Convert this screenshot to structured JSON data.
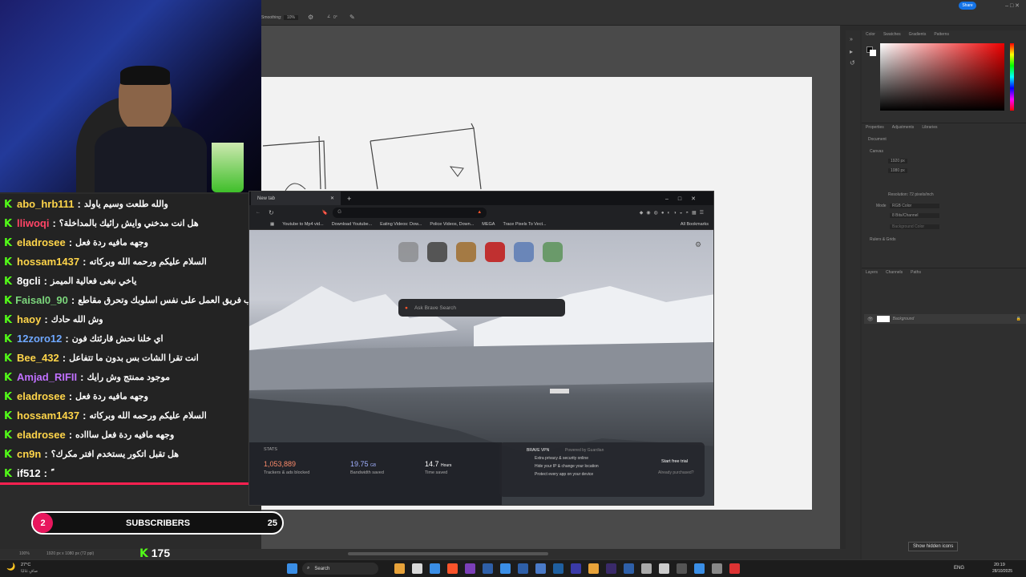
{
  "photoshop": {
    "options": {
      "smoothing": "Smoothing:",
      "smoothing_val": "10%",
      "angle": "0°",
      "share": "Share"
    },
    "right_tabs": [
      "Color",
      "Swatches",
      "Gradients",
      "Patterns"
    ],
    "props_tabs": [
      "Properties",
      "Adjustments",
      "Libraries"
    ],
    "doc_label": "Document",
    "canvas_label": "Canvas",
    "w": "1920 px",
    "h": "1080 px",
    "resolution": "Resolution: 72 pixels/inch",
    "mode_label": "Mode",
    "mode": "RGB Color",
    "bits": "8 Bits/Channel",
    "fill": "Background Color",
    "rulers": "Rulers & Grids",
    "layers_tabs": [
      "Layers",
      "Channels",
      "Paths"
    ],
    "layer_name": "Background",
    "zoom": "100%",
    "doc_size": "1920 px x 1080 px (72 ppi)"
  },
  "chat": [
    {
      "user": "abo_hrb111",
      "color": "#ffd54a",
      "text": "والله طلعت وسيم ياولد"
    },
    {
      "user": "lliwoqi",
      "color": "#ff4466",
      "text": "هل انت مدخني وايش رائيك بالمداخلة؟"
    },
    {
      "user": "eladrosee",
      "color": "#ffd54a",
      "text": "وجهه مافيه ردة فعل"
    },
    {
      "user": "hossam1437",
      "color": "#ffd54a",
      "text": "السلام عليكم ورحمه الله وبركاته"
    },
    {
      "user": "8gcli",
      "color": "#ffffff",
      "text": "ياخي نبغى فعالية الميمز"
    },
    {
      "user": "Faisal0_90",
      "color": "#7cd67c",
      "text": "لو تجيب فريق العمل على نفس اسلوبك وتحرق مقاطع"
    },
    {
      "user": "haoy",
      "color": "#ffd54a",
      "text": "وش الله حادك"
    },
    {
      "user": "12zoro12",
      "color": "#6fa8ff",
      "text": "اي خلنا نحش قارئتك فون"
    },
    {
      "user": "Bee_432",
      "color": "#ffd54a",
      "text": "انت تقرا الشات بس بدون ما تتفاعل"
    },
    {
      "user": "Amjad_RIFII",
      "color": "#c070ff",
      "text": "موجود ممنتج وش رايك"
    },
    {
      "user": "eladrosee",
      "color": "#ffd54a",
      "text": "وجهه مافيه ردة فعل"
    },
    {
      "user": "hossam1437",
      "color": "#ffd54a",
      "text": "السلام عليكم ورحمه الله وبركاته"
    },
    {
      "user": "eladrosee",
      "color": "#ffd54a",
      "text": "وجهه مافيه ردة فعل ساااده"
    },
    {
      "user": "cn9n",
      "color": "#ffd54a",
      "text": "هل تقبل اتكور يستخدم افتر مكرك؟"
    },
    {
      "user": "if512",
      "color": "#ffffff",
      "text": "ً"
    }
  ],
  "subs": {
    "left": "2",
    "label": "SUBSCRIBERS",
    "right": "25",
    "count": "175"
  },
  "browser": {
    "tab": "New tab",
    "bookmarks": [
      "Youtube to Mp4 vid...",
      "Download Youtube...",
      "Eating Videos: Dow...",
      "Police Videos, Down...",
      "MEGA",
      "Trace Pixels To Vect..."
    ],
    "all_bookmarks": "All Bookmarks",
    "search_placeholder": "Ask Brave Search",
    "stats": {
      "label": "STATS",
      "blocked": "1,053,889",
      "blocked_label": "Trackers & ads blocked",
      "bw": "19.75",
      "bw_unit": "GB",
      "bw_label": "Bandwidth saved",
      "time": "14.7",
      "time_unit": "Hours",
      "time_label": "Time saved"
    },
    "vpn": {
      "title": "BRAVE VPN",
      "powered": "Powered by Guardian",
      "items": [
        "Extra privacy & security online",
        "Hide your IP & change your location",
        "Protect every app on your device"
      ],
      "cta": "Start free trial",
      "already": "Already purchased?"
    }
  },
  "taskbar": {
    "weather": "27°C",
    "weather_sub": "صافٍ غالبًا",
    "search": "Search",
    "lang": "ENG",
    "time": "20:19",
    "date": "28/10/2025",
    "tooltip": "Show hidden icons"
  }
}
